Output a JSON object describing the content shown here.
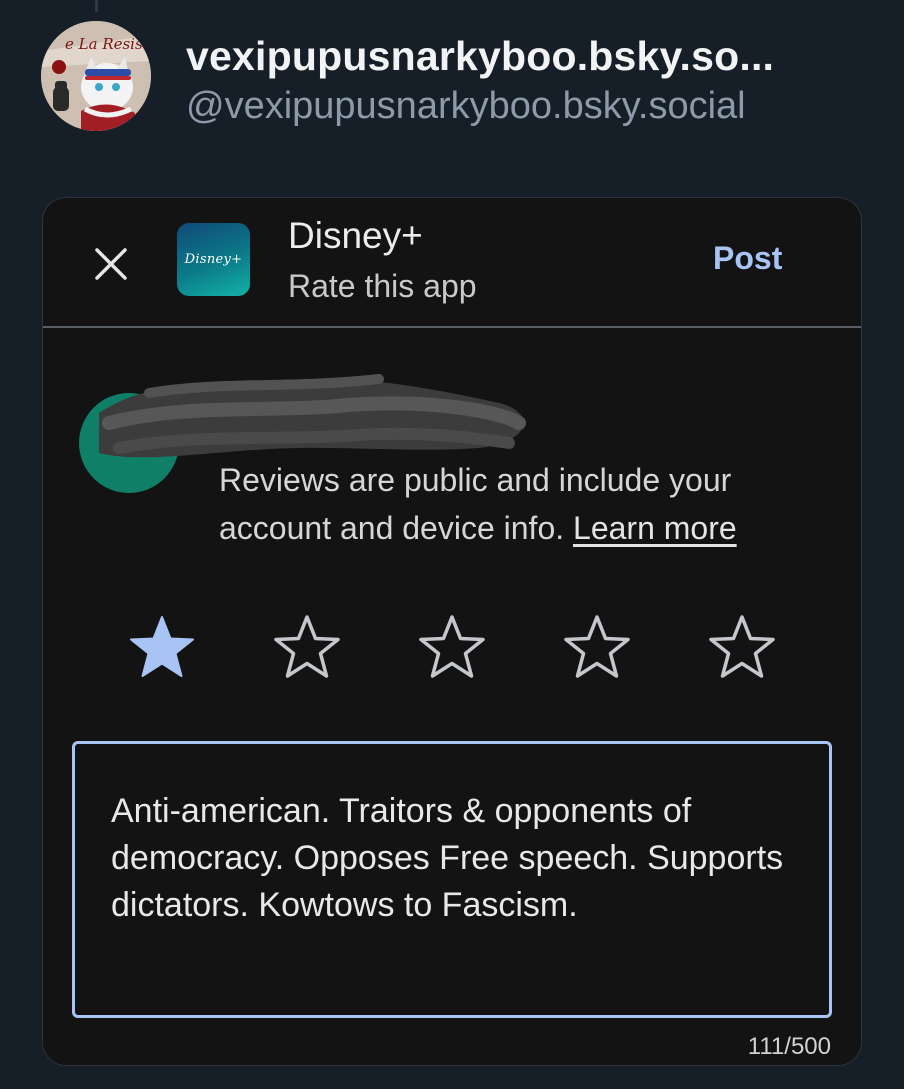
{
  "post": {
    "display_name": "vexipupusnarkyboo.bsky.so...",
    "handle": "@vexipupusnarkyboo.bsky.social",
    "avatar_text": "e La Resistan"
  },
  "dialog": {
    "close_icon": "close-icon",
    "app_icon_label": "Disney+",
    "app_title": "Disney+",
    "app_subtitle": "Rate this app",
    "post_label": "Post",
    "privacy_text": "Reviews are public and include your account and device info.",
    "learn_more_label": "Learn more",
    "rating": {
      "value": 1,
      "max": 5
    },
    "review_text": "Anti-american. Traitors & opponents of democracy. Opposes Free speech. Supports dictators. Kowtows to Fascism.",
    "char_count": "111/500"
  },
  "colors": {
    "background": "#161e27",
    "card": "#131313",
    "accent": "#a8c4f4",
    "handle": "#8d9aaa",
    "star_outline": "#c4c7cc"
  }
}
